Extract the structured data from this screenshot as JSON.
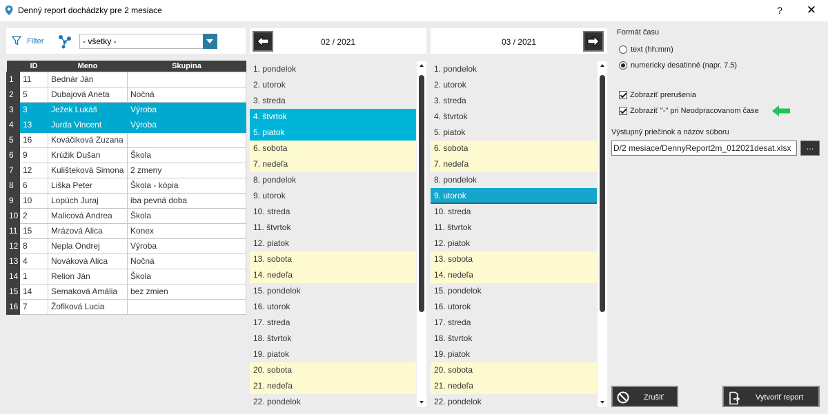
{
  "window": {
    "title": "Denný report dochádzky pre 2 mesiace",
    "help_label": "?",
    "close_label": "✕"
  },
  "filter": {
    "label": "Filter",
    "group_select_value": "- všetky -"
  },
  "employees": {
    "columns": [
      "",
      "ID",
      "Meno",
      "Skupina"
    ],
    "rows": [
      {
        "n": "1",
        "id": "11",
        "name": "Bednár Ján",
        "group": "",
        "selected": false
      },
      {
        "n": "2",
        "id": "5",
        "name": "Dubajová Aneta",
        "group": "Nočná",
        "selected": false
      },
      {
        "n": "3",
        "id": "3",
        "name": "Ježek Lukáš",
        "group": "Výroba",
        "selected": true
      },
      {
        "n": "4",
        "id": "13",
        "name": "Jurda Vincent",
        "group": "Výroba",
        "selected": true
      },
      {
        "n": "5",
        "id": "16",
        "name": "Kováčiková Zuzana",
        "group": "",
        "selected": false
      },
      {
        "n": "6",
        "id": "9",
        "name": "Krúžik Dušan",
        "group": "Škola",
        "selected": false
      },
      {
        "n": "7",
        "id": "12",
        "name": "Kulištеková Simona",
        "group": "2 zmeny",
        "selected": false
      },
      {
        "n": "8",
        "id": "6",
        "name": "Liška Peter",
        "group": "Škola - kópia",
        "selected": false
      },
      {
        "n": "9",
        "id": "10",
        "name": "Lopúch Juraj",
        "group": "iba pevná doba",
        "selected": false
      },
      {
        "n": "10",
        "id": "2",
        "name": "Malicová Andrea",
        "group": "Škola",
        "selected": false
      },
      {
        "n": "11",
        "id": "15",
        "name": "Mrázová Alica",
        "group": "Konex",
        "selected": false
      },
      {
        "n": "12",
        "id": "8",
        "name": "Nepla Ondrej",
        "group": "Výroba",
        "selected": false
      },
      {
        "n": "13",
        "id": "4",
        "name": "Nováková Alica",
        "group": "Nočná",
        "selected": false
      },
      {
        "n": "14",
        "id": "1",
        "name": "Relion Ján",
        "group": "Škola",
        "selected": false
      },
      {
        "n": "15",
        "id": "14",
        "name": "Semaková Amália",
        "group": "bez zmien",
        "selected": false
      },
      {
        "n": "16",
        "id": "7",
        "name": "Žofiková Lucia",
        "group": "",
        "selected": false
      }
    ]
  },
  "month1": {
    "label": "02 / 2021",
    "days": [
      {
        "t": "1. pondelok",
        "k": ""
      },
      {
        "t": "2. utorok",
        "k": ""
      },
      {
        "t": "3. streda",
        "k": ""
      },
      {
        "t": "4. štvrtok",
        "k": "sel"
      },
      {
        "t": "5. piatok",
        "k": "sel"
      },
      {
        "t": "6. sobota",
        "k": "weekend"
      },
      {
        "t": "7. nedeľa",
        "k": "weekend"
      },
      {
        "t": "8. pondelok",
        "k": ""
      },
      {
        "t": "9. utorok",
        "k": ""
      },
      {
        "t": "10. streda",
        "k": ""
      },
      {
        "t": "11. štvrtok",
        "k": ""
      },
      {
        "t": "12. piatok",
        "k": ""
      },
      {
        "t": "13. sobota",
        "k": "weekend"
      },
      {
        "t": "14. nedeľa",
        "k": "weekend"
      },
      {
        "t": "15. pondelok",
        "k": ""
      },
      {
        "t": "16. utorok",
        "k": ""
      },
      {
        "t": "17. streda",
        "k": ""
      },
      {
        "t": "18. štvrtok",
        "k": ""
      },
      {
        "t": "19. piatok",
        "k": ""
      },
      {
        "t": "20. sobota",
        "k": "weekend"
      },
      {
        "t": "21. nedeľa",
        "k": "weekend"
      },
      {
        "t": "22. pondelok",
        "k": ""
      }
    ]
  },
  "month2": {
    "label": "03 / 2021",
    "days": [
      {
        "t": "1. pondelok",
        "k": ""
      },
      {
        "t": "2. utorok",
        "k": ""
      },
      {
        "t": "3. streda",
        "k": ""
      },
      {
        "t": "4. štvrtok",
        "k": ""
      },
      {
        "t": "5. piatok",
        "k": ""
      },
      {
        "t": "6. sobota",
        "k": "weekend"
      },
      {
        "t": "7. nedeľa",
        "k": "weekend"
      },
      {
        "t": "8. pondelok",
        "k": ""
      },
      {
        "t": "9. utorok",
        "k": "sel2"
      },
      {
        "t": "10. streda",
        "k": ""
      },
      {
        "t": "11. štvrtok",
        "k": ""
      },
      {
        "t": "12. piatok",
        "k": ""
      },
      {
        "t": "13. sobota",
        "k": "weekend"
      },
      {
        "t": "14. nedeľa",
        "k": "weekend"
      },
      {
        "t": "15. pondelok",
        "k": ""
      },
      {
        "t": "16. utorok",
        "k": ""
      },
      {
        "t": "17. streda",
        "k": ""
      },
      {
        "t": "18. štvrtok",
        "k": ""
      },
      {
        "t": "19. piatok",
        "k": ""
      },
      {
        "t": "20. sobota",
        "k": "weekend"
      },
      {
        "t": "21. nedeľa",
        "k": "weekend"
      },
      {
        "t": "22. pondelok",
        "k": ""
      }
    ]
  },
  "options": {
    "time_format_label": "Formát času",
    "radio_text": "text (hh:mm)",
    "radio_decimal": "numericky desatinné (napr. 7.5)",
    "check_breaks": "Zobraziť prerušenia",
    "check_dash": "Zobraziť \"-\" pri Neodpracovanom čase",
    "output_label": "Výstupný priečinok a názov súboru",
    "output_path": "D/2 mesiace/DennyReport2m_012021desat.xlsx",
    "browse_label": "...",
    "cancel_label": "Zrušiť",
    "create_label": "Vytvoriť report"
  },
  "colors": {
    "selection": "#00a9cf",
    "weekend": "#fdfad0",
    "header_dark": "#3f3f3f",
    "arrow_green": "#22c25a"
  }
}
